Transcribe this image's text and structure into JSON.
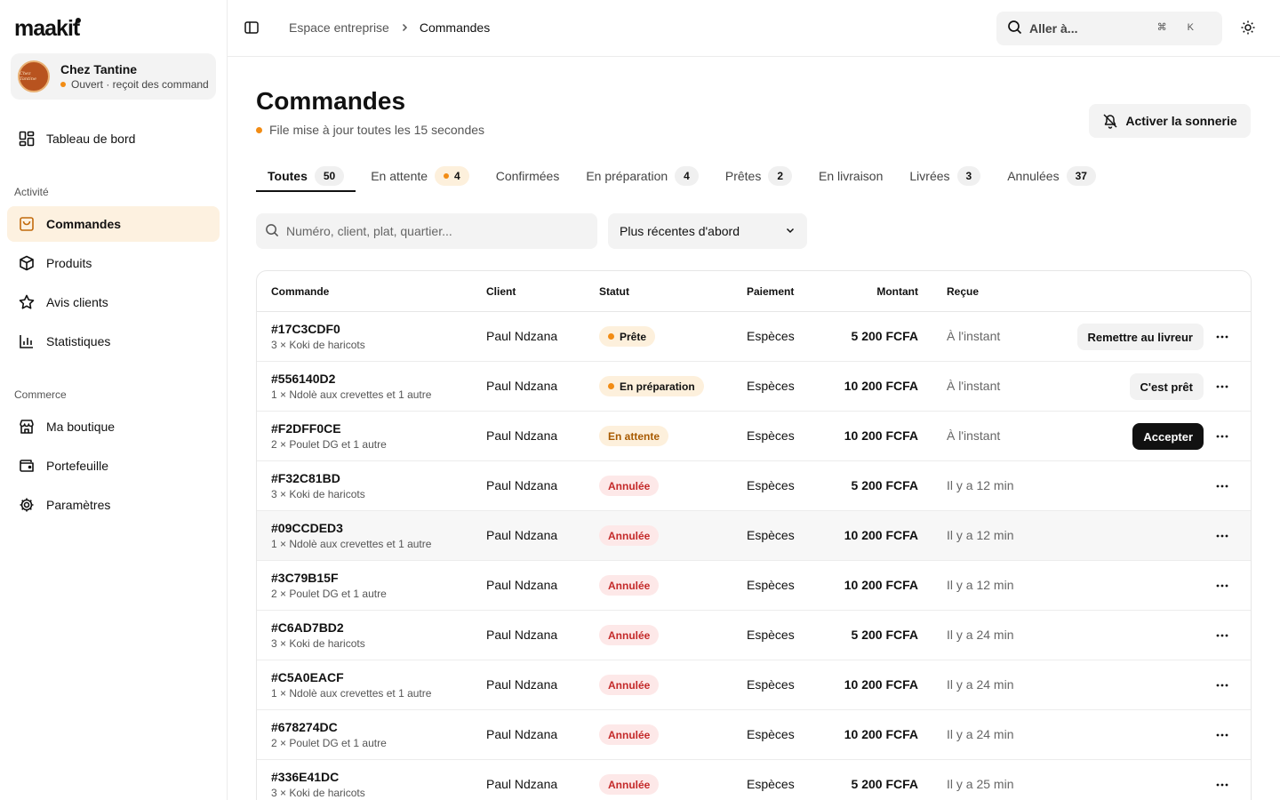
{
  "brand": {
    "name": "maakit",
    "accent": "#f28c14"
  },
  "store": {
    "name": "Chez Tantine",
    "status": "Ouvert · reçoit des commandes",
    "avatar_text": "Chez Tantine"
  },
  "nav": {
    "dashboard": "Tableau de bord",
    "section_activity": "Activité",
    "orders": "Commandes",
    "products": "Produits",
    "reviews": "Avis clients",
    "stats": "Statistiques",
    "section_commerce": "Commerce",
    "shop": "Ma boutique",
    "wallet": "Portefeuille",
    "settings": "Paramètres"
  },
  "topbar": {
    "breadcrumb_parent": "Espace entreprise",
    "breadcrumb_current": "Commandes",
    "search_placeholder": "Aller à...",
    "shortcut": "⌘ K"
  },
  "page": {
    "title": "Commandes",
    "subtitle": "File mise à jour toutes les 15 secondes",
    "ring_button": "Activer la sonnerie"
  },
  "tabs": [
    {
      "label": "Toutes",
      "count": "50"
    },
    {
      "label": "En attente",
      "count": "4"
    },
    {
      "label": "Confirmées",
      "count": ""
    },
    {
      "label": "En préparation",
      "count": "4"
    },
    {
      "label": "Prêtes",
      "count": "2"
    },
    {
      "label": "En livraison",
      "count": ""
    },
    {
      "label": "Livrées",
      "count": "3"
    },
    {
      "label": "Annulées",
      "count": "37"
    }
  ],
  "filters": {
    "search_placeholder": "Numéro, client, plat, quartier...",
    "sort_value": "Plus récentes d'abord"
  },
  "table": {
    "headers": {
      "order": "Commande",
      "client": "Client",
      "status": "Statut",
      "payment": "Paiement",
      "amount": "Montant",
      "received": "Reçue"
    },
    "rows": [
      {
        "id": "#17C3CDF0",
        "items": "3 × Koki de haricots",
        "client": "Paul Ndzana",
        "status": "Prête",
        "payment": "Espèces",
        "amount": "5 200 FCFA",
        "received": "À l'instant",
        "action": "Remettre au livreur"
      },
      {
        "id": "#556140D2",
        "items": "1 × Ndolè aux crevettes et 1 autre",
        "client": "Paul Ndzana",
        "status": "En préparation",
        "payment": "Espèces",
        "amount": "10 200 FCFA",
        "received": "À l'instant",
        "action": "C'est prêt"
      },
      {
        "id": "#F2DFF0CE",
        "items": "2 × Poulet DG et 1 autre",
        "client": "Paul Ndzana",
        "status": "En attente",
        "payment": "Espèces",
        "amount": "10 200 FCFA",
        "received": "À l'instant",
        "action": "Accepter"
      },
      {
        "id": "#F32C81BD",
        "items": "3 × Koki de haricots",
        "client": "Paul Ndzana",
        "status": "Annulée",
        "payment": "Espèces",
        "amount": "5 200 FCFA",
        "received": "Il y a 12 min",
        "action": ""
      },
      {
        "id": "#09CCDED3",
        "items": "1 × Ndolè aux crevettes et 1 autre",
        "client": "Paul Ndzana",
        "status": "Annulée",
        "payment": "Espèces",
        "amount": "10 200 FCFA",
        "received": "Il y a 12 min",
        "action": ""
      },
      {
        "id": "#3C79B15F",
        "items": "2 × Poulet DG et 1 autre",
        "client": "Paul Ndzana",
        "status": "Annulée",
        "payment": "Espèces",
        "amount": "10 200 FCFA",
        "received": "Il y a 12 min",
        "action": ""
      },
      {
        "id": "#C6AD7BD2",
        "items": "3 × Koki de haricots",
        "client": "Paul Ndzana",
        "status": "Annulée",
        "payment": "Espèces",
        "amount": "5 200 FCFA",
        "received": "Il y a 24 min",
        "action": ""
      },
      {
        "id": "#C5A0EACF",
        "items": "1 × Ndolè aux crevettes et 1 autre",
        "client": "Paul Ndzana",
        "status": "Annulée",
        "payment": "Espèces",
        "amount": "10 200 FCFA",
        "received": "Il y a 24 min",
        "action": ""
      },
      {
        "id": "#678274DC",
        "items": "2 × Poulet DG et 1 autre",
        "client": "Paul Ndzana",
        "status": "Annulée",
        "payment": "Espèces",
        "amount": "10 200 FCFA",
        "received": "Il y a 24 min",
        "action": ""
      },
      {
        "id": "#336E41DC",
        "items": "3 × Koki de haricots",
        "client": "Paul Ndzana",
        "status": "Annulée",
        "payment": "Espèces",
        "amount": "5 200 FCFA",
        "received": "Il y a 25 min",
        "action": ""
      }
    ]
  }
}
